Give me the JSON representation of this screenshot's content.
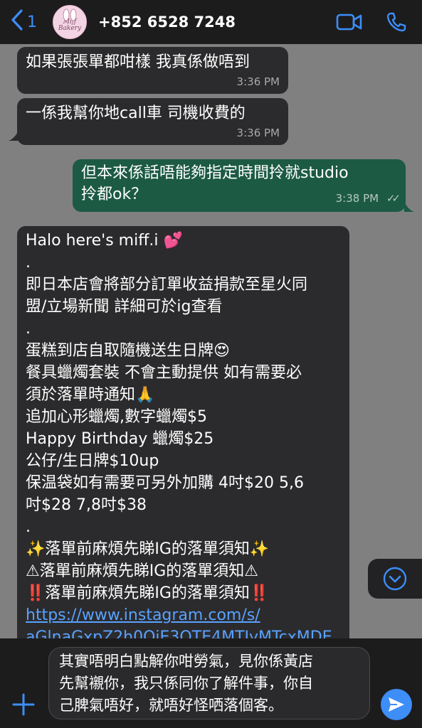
{
  "header": {
    "back_count": "1",
    "avatar_text": "Miff Bakery",
    "contact_name": "+852 6528 7248"
  },
  "icons": {
    "back": "chevron-left-icon",
    "video": "video-call-icon",
    "phone": "phone-icon",
    "scroll_down": "chevron-down-circle-icon",
    "attach": "plus-icon",
    "send": "send-icon"
  },
  "colors": {
    "accent": "#3d8ef7",
    "incoming_bubble": "#2b2b2d",
    "outgoing_bubble": "#1c5a44",
    "link": "#5aa2ff"
  },
  "messages": [
    {
      "direction": "in",
      "text": "如果張張單都咁樣 我真係做唔到",
      "time": "3:36 PM"
    },
    {
      "direction": "in",
      "text": "一係我幫你地call車 司機收費的",
      "time": "3:36 PM"
    },
    {
      "direction": "out",
      "lines": [
        "但本來係話唔能夠指定時間拎就studio",
        "拎都ok？"
      ],
      "time": "3:38 PM"
    },
    {
      "direction": "in",
      "lines": [
        "Halo here's miff.i 💕",
        ".",
        "即日本店會將部分訂單收益捐款至星火同",
        "盟/立場新聞 詳細可於ig查看",
        ".",
        "蛋糕到店自取隨機送生日牌😍",
        "餐具蠟燭套裝 不會主動提供 如有需要必",
        "須於落單時通知🙏",
        "追加心形蠟燭,數字蠟燭$5",
        "Happy Birthday 蠟燭$25",
        "公仔/生日牌$10up",
        "保温袋如有需要可另外加購 4吋$20 5,6",
        "吋$28 7,8吋$38",
        ".",
        "✨落單前麻煩先睇IG的落單須知✨",
        "⚠落單前麻煩先睇IG的落單須知⚠",
        "‼️落單前麻煩先睇IG的落單須知‼️"
      ],
      "link_1": "https://www.instagram.com/s/",
      "link_2": "aGlnaGxpZ2h0OjE3OTE4MTIyMTcxMDE"
    }
  ],
  "composer": {
    "draft_lines": [
      "其實唔明白點解你咁勞氣，見你係黃店",
      "先幫襯你，我只係同你了解件事，你自",
      "己脾氣唔好，就唔好怪哂落個客。"
    ]
  }
}
